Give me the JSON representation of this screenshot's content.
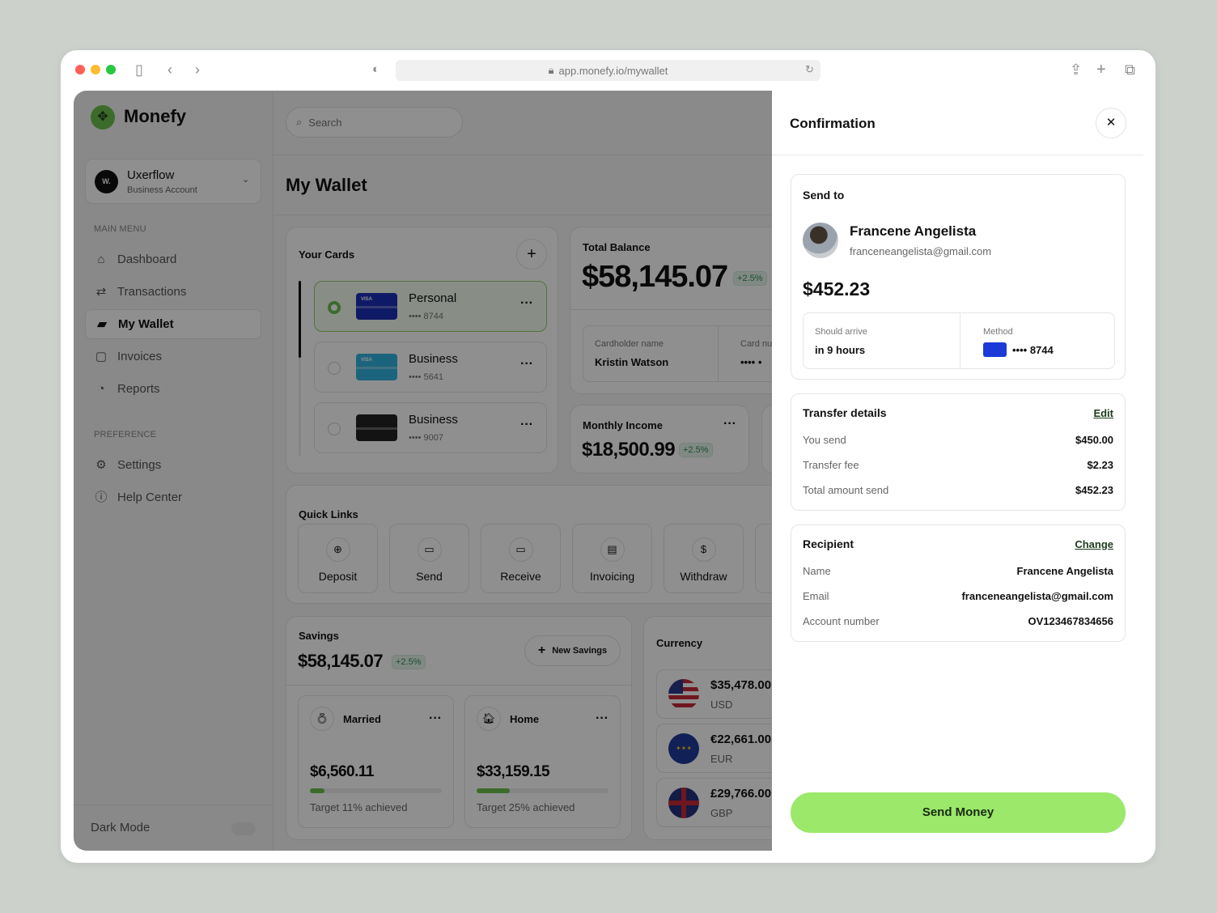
{
  "browser": {
    "url": "app.monefy.io/mywallet"
  },
  "sidebar": {
    "brand": "Monefy",
    "account": {
      "name": "Uxerflow",
      "type": "Business Account",
      "avatar": "W."
    },
    "main_menu_label": "MAIN MENU",
    "items": [
      {
        "label": "Dashboard"
      },
      {
        "label": "Transactions"
      },
      {
        "label": "My Wallet"
      },
      {
        "label": "Invoices"
      },
      {
        "label": "Reports"
      }
    ],
    "preference_label": "PREFERENCE",
    "pref_items": [
      {
        "label": "Settings"
      },
      {
        "label": "Help Center"
      }
    ],
    "dark_mode": "Dark Mode"
  },
  "header": {
    "search_placeholder": "Search",
    "title": "My Wallet"
  },
  "cards": {
    "title": "Your Cards",
    "items": [
      {
        "name": "Personal",
        "number": "•••• 8744",
        "brand": "VISA"
      },
      {
        "name": "Business",
        "number": "•••• 5641",
        "brand": "VISA"
      },
      {
        "name": "Business",
        "number": "•••• 9007"
      }
    ]
  },
  "balance": {
    "title": "Total Balance",
    "value": "$58,145.07",
    "change": "+2.5%",
    "cardholder_label": "Cardholder name",
    "cardholder": "Kristin Watson",
    "card_number_label": "Card nu",
    "card_number": "•••• •"
  },
  "income": {
    "title": "Monthly Income",
    "value": "$18,500.99",
    "change": "+2.5%"
  },
  "quick_links": {
    "title": "Quick Links",
    "items": [
      {
        "label": "Deposit"
      },
      {
        "label": "Send"
      },
      {
        "label": "Receive"
      },
      {
        "label": "Invoicing"
      },
      {
        "label": "Withdraw"
      }
    ]
  },
  "savings": {
    "title": "Savings",
    "value": "$58,145.07",
    "change": "+2.5%",
    "new_label": "New Savings",
    "items": [
      {
        "name": "Married",
        "amount": "$6,560.11",
        "progress": 11,
        "target": "Target 11% achieved"
      },
      {
        "name": "Home",
        "amount": "$33,159.15",
        "progress": 25,
        "target": "Target 25% achieved"
      }
    ]
  },
  "currency": {
    "title": "Currency",
    "items": [
      {
        "amount": "$35,478.00",
        "code": "USD"
      },
      {
        "amount": "€22,661.00",
        "code": "EUR"
      },
      {
        "amount": "£29,766.00",
        "code": "GBP"
      }
    ]
  },
  "confirm": {
    "title": "Confirmation",
    "send_to": "Send to",
    "name": "Francene Angelista",
    "email": "franceneangelista@gmail.com",
    "amount": "$452.23",
    "arrive_label": "Should arrive",
    "arrive": "in 9 hours",
    "method_label": "Method",
    "method": "•••• 8744",
    "transfer": {
      "title": "Transfer details",
      "edit": "Edit",
      "rows": [
        {
          "label": "You send",
          "value": "$450.00"
        },
        {
          "label": "Transfer fee",
          "value": "$2.23"
        },
        {
          "label": "Total amount send",
          "value": "$452.23"
        }
      ]
    },
    "recipient": {
      "title": "Recipient",
      "change": "Change",
      "rows": [
        {
          "label": "Name",
          "value": "Francene Angelista"
        },
        {
          "label": "Email",
          "value": "franceneangelista@gmail.com"
        },
        {
          "label": "Account number",
          "value": "OV123467834656"
        }
      ]
    },
    "submit": "Send Money"
  },
  "colors": {
    "accent": "#9be86b",
    "brand": "#6bbf4e"
  }
}
